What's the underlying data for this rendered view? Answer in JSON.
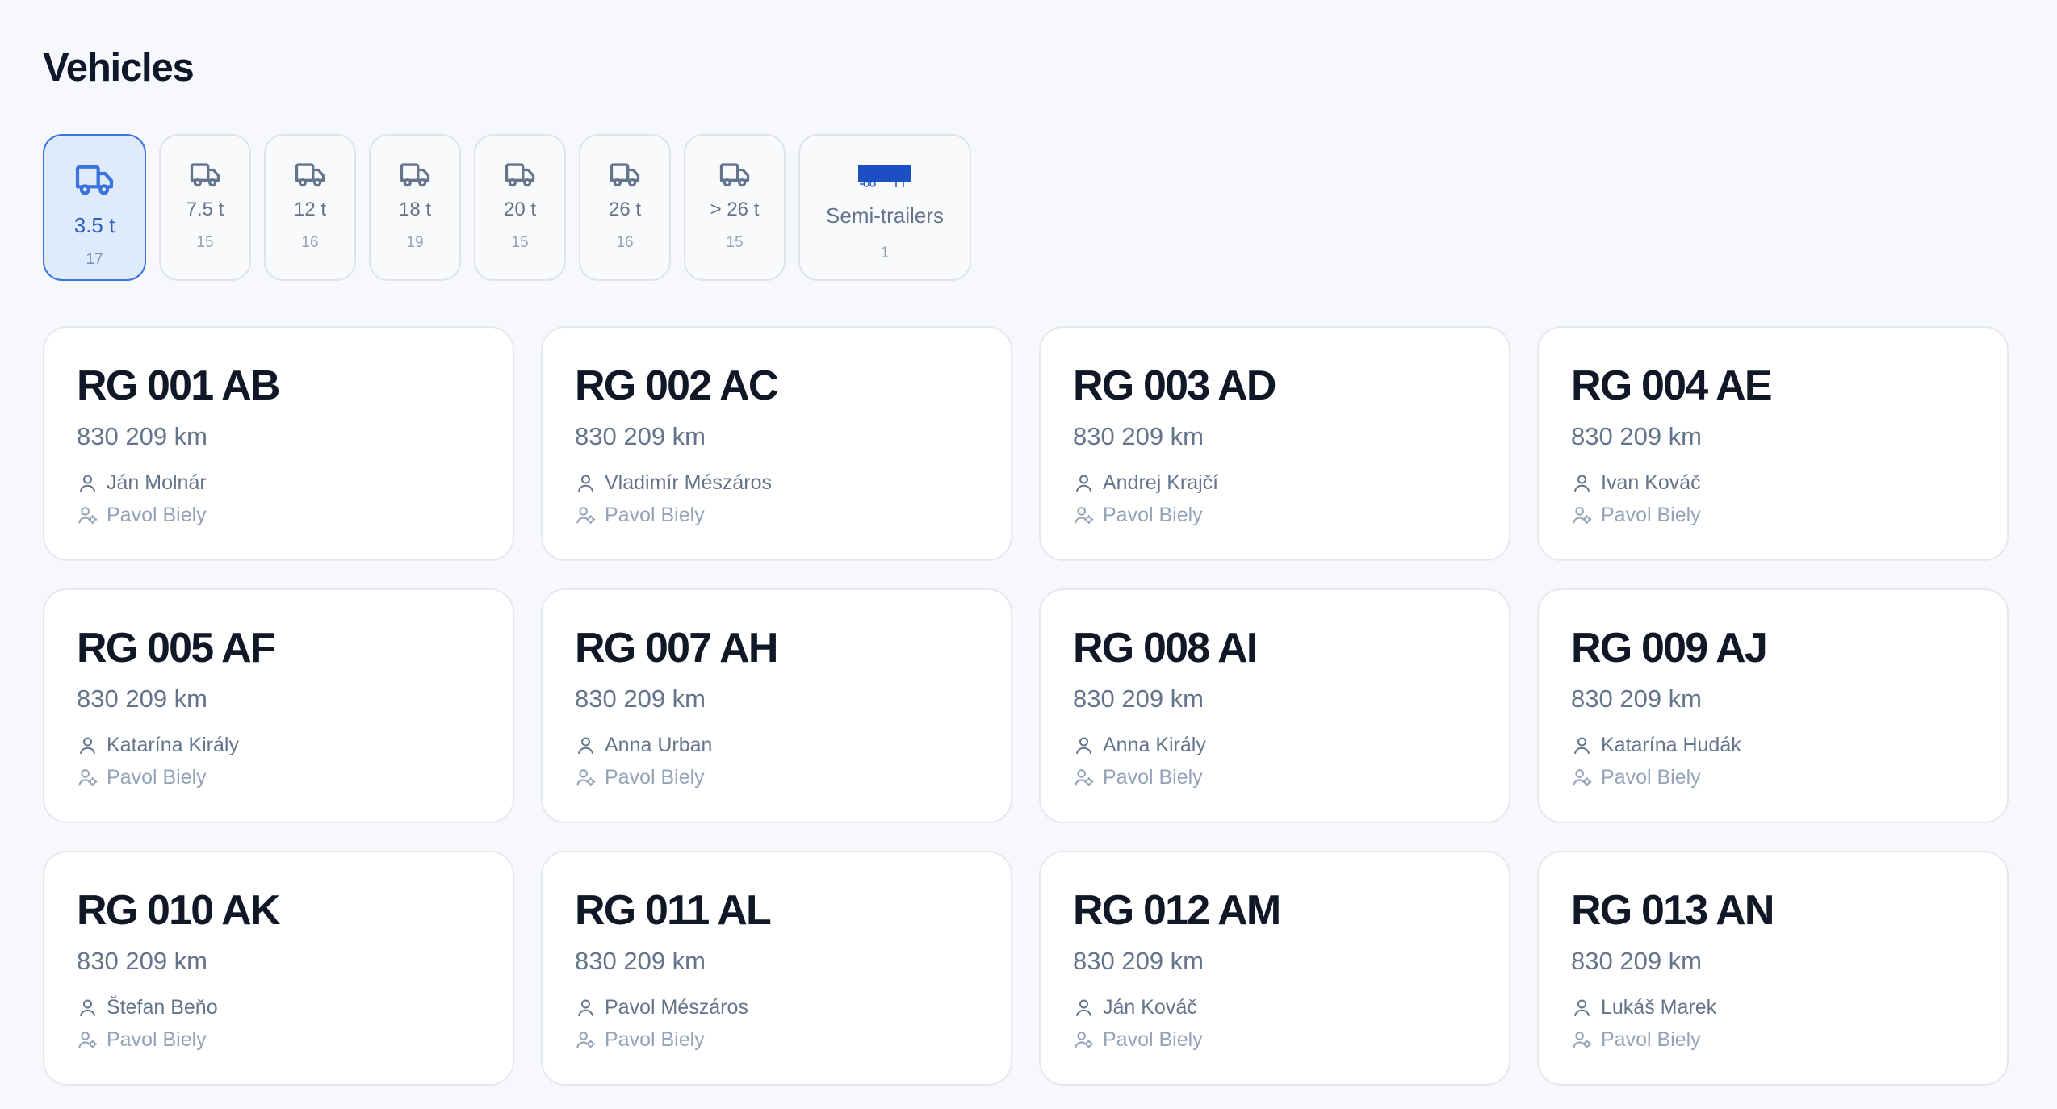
{
  "page": {
    "title": "Vehicles"
  },
  "filters": [
    {
      "label": "3.5 t",
      "count": "17",
      "active": true,
      "icon": "truck-icon"
    },
    {
      "label": "7.5 t",
      "count": "15",
      "active": false,
      "icon": "truck-icon"
    },
    {
      "label": "12 t",
      "count": "16",
      "active": false,
      "icon": "truck-icon"
    },
    {
      "label": "18 t",
      "count": "19",
      "active": false,
      "icon": "truck-icon"
    },
    {
      "label": "20 t",
      "count": "15",
      "active": false,
      "icon": "truck-icon"
    },
    {
      "label": "26 t",
      "count": "16",
      "active": false,
      "icon": "truck-icon"
    },
    {
      "label": "> 26 t",
      "count": "15",
      "active": false,
      "icon": "truck-icon"
    },
    {
      "label": "Semi-trailers",
      "count": "1",
      "active": false,
      "icon": "semi-trailer-icon"
    }
  ],
  "vehicles": [
    {
      "plate": "RG 001 AB",
      "km": "830 209 km",
      "driver": "Ján Molnár",
      "manager": "Pavol Biely"
    },
    {
      "plate": "RG 002 AC",
      "km": "830 209 km",
      "driver": "Vladimír Mészáros",
      "manager": "Pavol Biely"
    },
    {
      "plate": "RG 003 AD",
      "km": "830 209 km",
      "driver": "Andrej Krajčí",
      "manager": "Pavol Biely"
    },
    {
      "plate": "RG 004 AE",
      "km": "830 209 km",
      "driver": "Ivan Kováč",
      "manager": "Pavol Biely"
    },
    {
      "plate": "RG 005 AF",
      "km": "830 209 km",
      "driver": "Katarína Király",
      "manager": "Pavol Biely"
    },
    {
      "plate": "RG 007 AH",
      "km": "830 209 km",
      "driver": "Anna Urban",
      "manager": "Pavol Biely"
    },
    {
      "plate": "RG 008 AI",
      "km": "830 209 km",
      "driver": "Anna Király",
      "manager": "Pavol Biely"
    },
    {
      "plate": "RG 009 AJ",
      "km": "830 209 km",
      "driver": "Katarína Hudák",
      "manager": "Pavol Biely"
    },
    {
      "plate": "RG 010 AK",
      "km": "830 209 km",
      "driver": "Štefan Beňo",
      "manager": "Pavol Biely"
    },
    {
      "plate": "RG 011 AL",
      "km": "830 209 km",
      "driver": "Pavol Mészáros",
      "manager": "Pavol Biely"
    },
    {
      "plate": "RG 012 AM",
      "km": "830 209 km",
      "driver": "Ján Kováč",
      "manager": "Pavol Biely"
    },
    {
      "plate": "RG 013 AN",
      "km": "830 209 km",
      "driver": "Lukáš Marek",
      "manager": "Pavol Biely"
    }
  ],
  "colors": {
    "background": "#f7f8fb",
    "accent": "#3b73df",
    "active_bg": "#dfeafb",
    "trailer": "#1d4fc4",
    "text_primary": "#0f172a",
    "text_secondary": "#64748b",
    "text_muted": "#94a3b8"
  }
}
